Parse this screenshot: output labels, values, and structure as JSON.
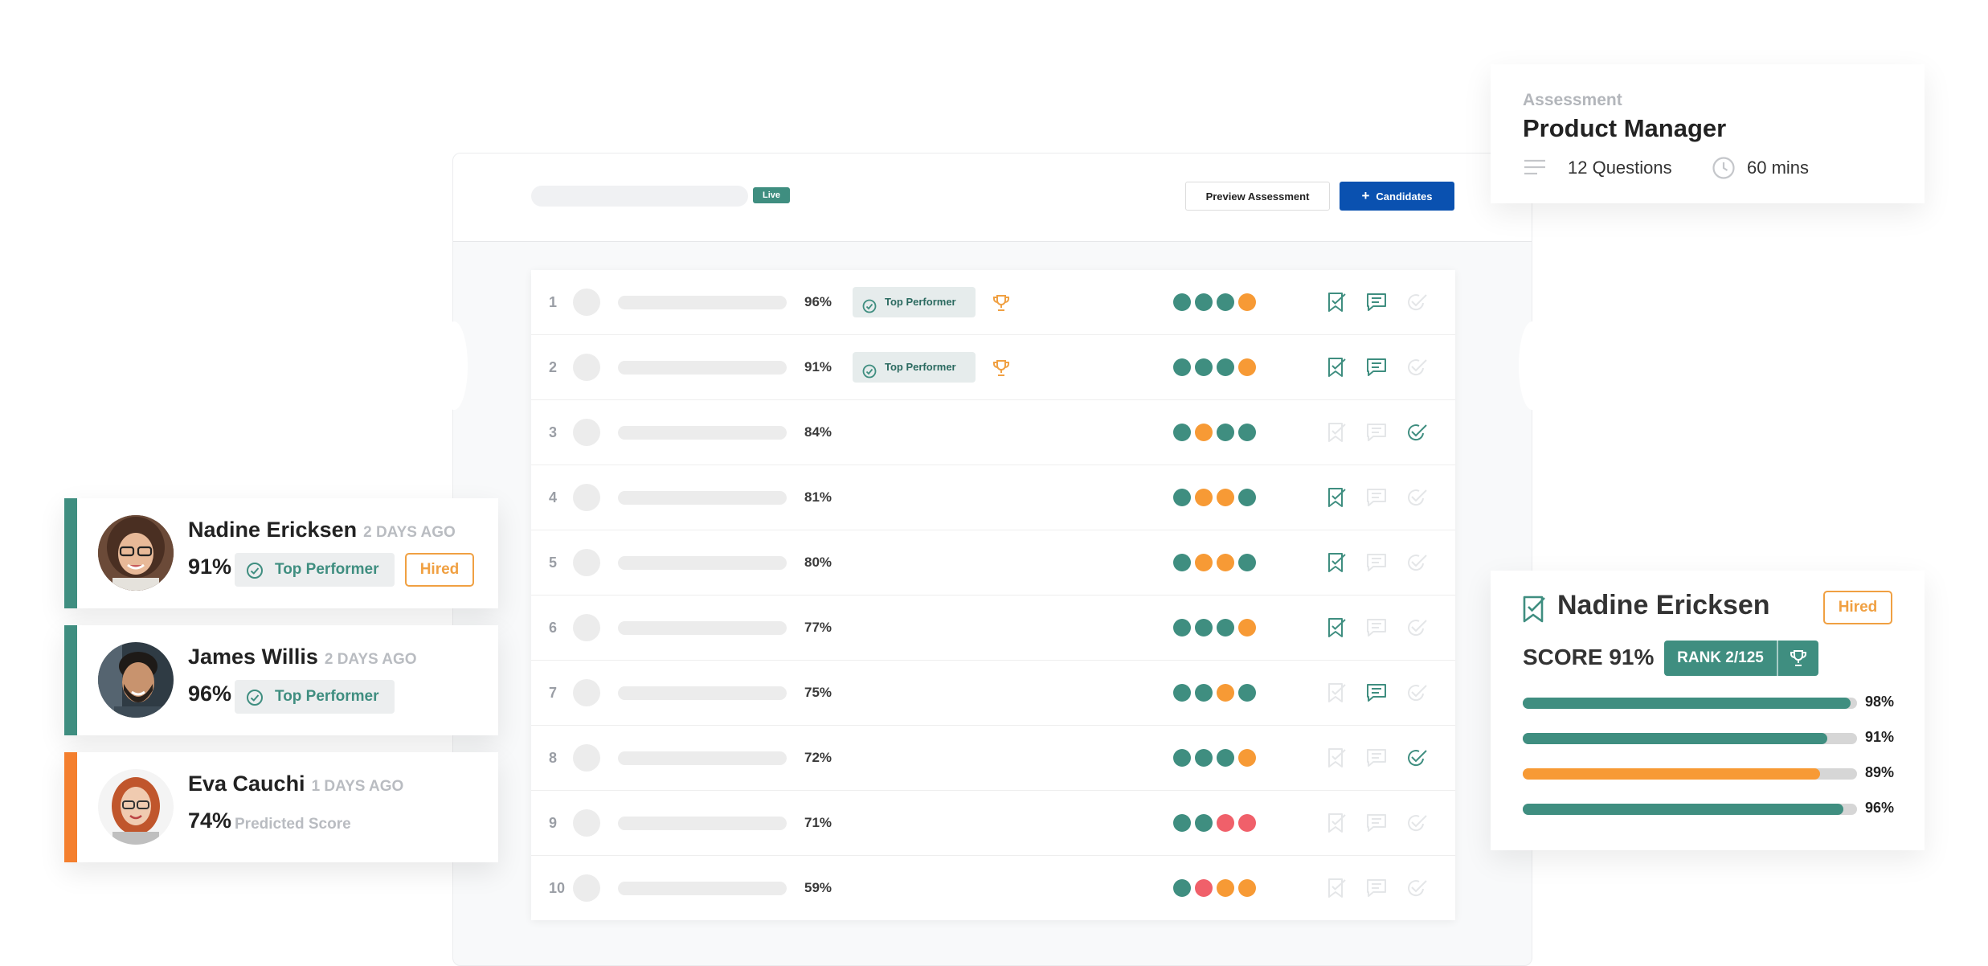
{
  "colors": {
    "teal": "#3f8e80",
    "orange": "#f79a35",
    "red": "#f0606a",
    "blue": "#0a51b0",
    "amber": "#f0a042"
  },
  "assessment_panel": {
    "live_badge": "Live",
    "preview_button": "Preview Assessment",
    "candidates_button": "Candidates",
    "candidates_button_icon": "plus-icon",
    "rows": [
      {
        "rank": "1",
        "score": "96%",
        "tag": "Top Performer",
        "trophy": true,
        "dots": [
          "teal",
          "teal",
          "teal",
          "orange"
        ],
        "shortlisted": true,
        "commented": true,
        "completed": false
      },
      {
        "rank": "2",
        "score": "91%",
        "tag": "Top Performer",
        "trophy": true,
        "dots": [
          "teal",
          "teal",
          "teal",
          "orange"
        ],
        "shortlisted": true,
        "commented": true,
        "completed": false
      },
      {
        "rank": "3",
        "score": "84%",
        "tag": "",
        "trophy": false,
        "dots": [
          "teal",
          "orange",
          "teal",
          "teal"
        ],
        "shortlisted": false,
        "commented": false,
        "completed": true
      },
      {
        "rank": "4",
        "score": "81%",
        "tag": "",
        "trophy": false,
        "dots": [
          "teal",
          "orange",
          "orange",
          "teal"
        ],
        "shortlisted": true,
        "commented": false,
        "completed": false
      },
      {
        "rank": "5",
        "score": "80%",
        "tag": "",
        "trophy": false,
        "dots": [
          "teal",
          "orange",
          "orange",
          "teal"
        ],
        "shortlisted": true,
        "commented": false,
        "completed": false
      },
      {
        "rank": "6",
        "score": "77%",
        "tag": "",
        "trophy": false,
        "dots": [
          "teal",
          "teal",
          "teal",
          "orange"
        ],
        "shortlisted": true,
        "commented": false,
        "completed": false
      },
      {
        "rank": "7",
        "score": "75%",
        "tag": "",
        "trophy": false,
        "dots": [
          "teal",
          "teal",
          "orange",
          "teal"
        ],
        "shortlisted": false,
        "commented": true,
        "completed": false
      },
      {
        "rank": "8",
        "score": "72%",
        "tag": "",
        "trophy": false,
        "dots": [
          "teal",
          "teal",
          "teal",
          "orange"
        ],
        "shortlisted": false,
        "commented": false,
        "completed": true
      },
      {
        "rank": "9",
        "score": "71%",
        "tag": "",
        "trophy": false,
        "dots": [
          "teal",
          "teal",
          "red",
          "red"
        ],
        "shortlisted": false,
        "commented": false,
        "completed": false
      },
      {
        "rank": "10",
        "score": "59%",
        "tag": "",
        "trophy": false,
        "dots": [
          "teal",
          "red",
          "orange",
          "orange"
        ],
        "shortlisted": false,
        "commented": false,
        "completed": false
      }
    ]
  },
  "candidate_cards": [
    {
      "name": "Nadine Ericksen",
      "ago": "2 DAYS AGO",
      "score": "91%",
      "tag": "Top Performer",
      "status": "Hired",
      "accent": "#3f8e80"
    },
    {
      "name": "James Willis",
      "ago": "2 DAYS AGO",
      "score": "96%",
      "tag": "Top Performer",
      "accent": "#3f8e80"
    },
    {
      "name": "Eva Cauchi",
      "ago": "1 DAYS AGO",
      "score": "74%",
      "note": "Predicted Score",
      "accent": "#f47f2e"
    }
  ],
  "assessment_card": {
    "label": "Assessment",
    "title": "Product Manager",
    "questions": "12 Questions",
    "duration": "60 mins"
  },
  "score_card": {
    "name": "Nadine Ericksen",
    "status": "Hired",
    "score_label": "SCORE",
    "score": "91%",
    "rank": "RANK 2/125",
    "bars": [
      {
        "value": 0.98,
        "label": "98%",
        "color": "#3f8e80"
      },
      {
        "value": 0.91,
        "label": "91%",
        "color": "#3f8e80"
      },
      {
        "value": 0.89,
        "label": "89%",
        "color": "#f79a35"
      },
      {
        "value": 0.96,
        "label": "96%",
        "color": "#3f8e80"
      }
    ]
  }
}
